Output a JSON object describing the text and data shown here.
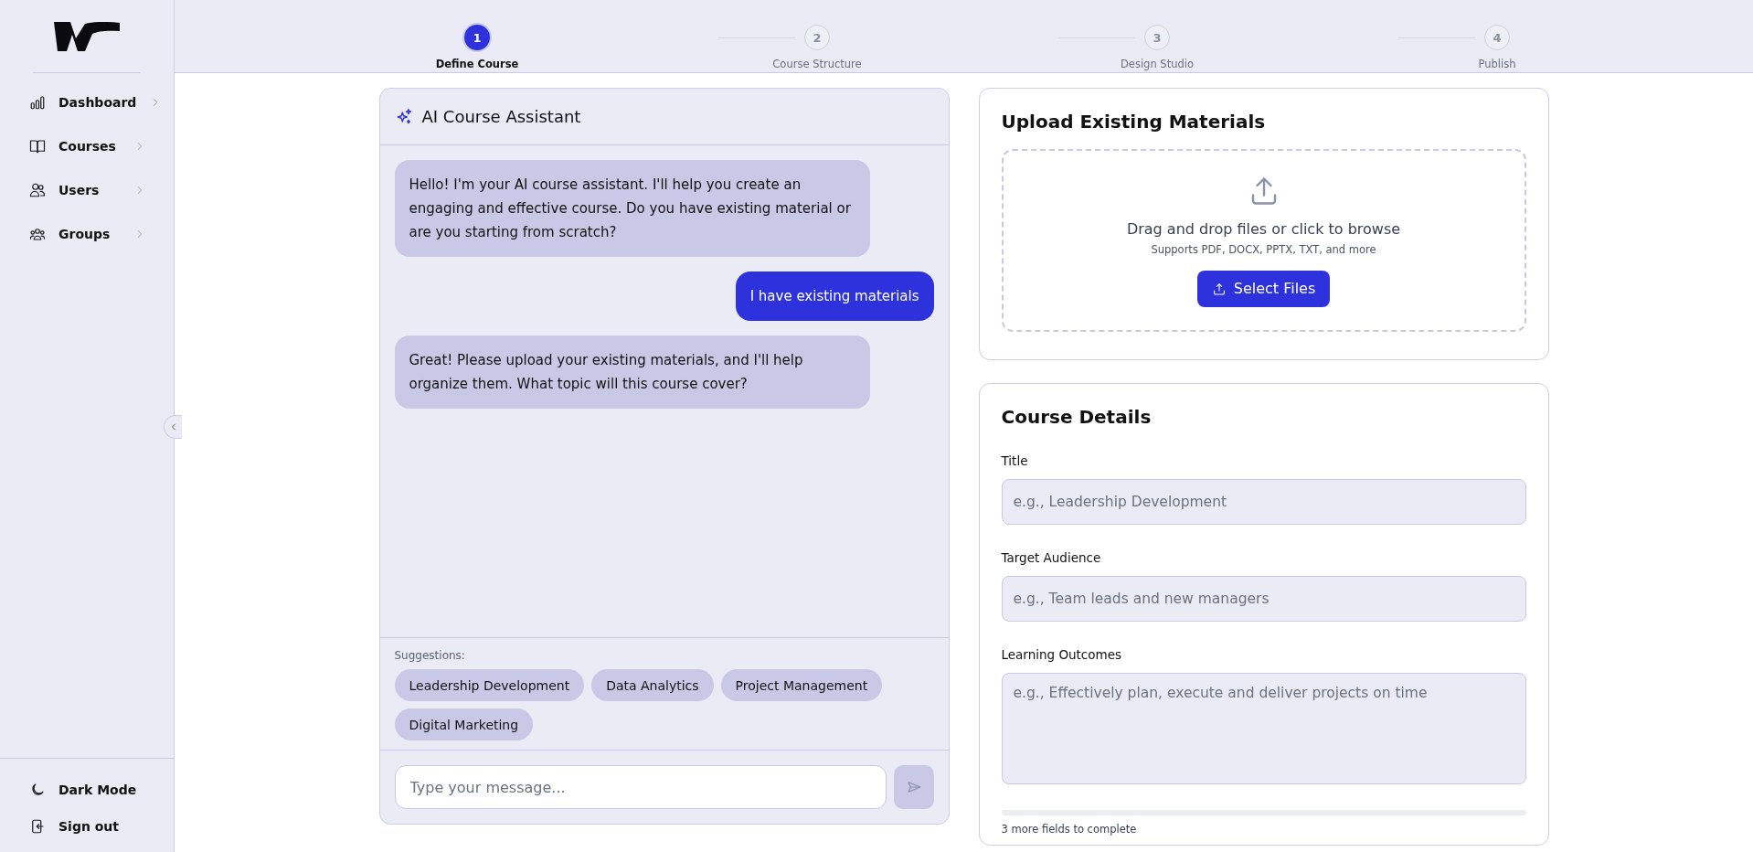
{
  "sidebar": {
    "nav_items": [
      {
        "label": "Dashboard"
      },
      {
        "label": "Courses"
      },
      {
        "label": "Users"
      },
      {
        "label": "Groups"
      }
    ],
    "footer_items": [
      {
        "label": "Dark Mode"
      },
      {
        "label": "Sign out"
      }
    ]
  },
  "stepper": [
    {
      "number": "1",
      "label": "Define Course",
      "selected": true
    },
    {
      "number": "2",
      "label": "Course Structure",
      "selected": false
    },
    {
      "number": "3",
      "label": "Design Studio",
      "selected": false
    },
    {
      "number": "4",
      "label": "Publish",
      "selected": false
    }
  ],
  "chat": {
    "title": "AI Course Assistant",
    "messages": [
      {
        "kind": "assistant",
        "text": "Hello! I'm your AI course assistant. I'll help you create an engaging and effective course. Do you have existing material or are you starting from scratch?"
      },
      {
        "kind": "user",
        "text": "I have existing materials"
      },
      {
        "kind": "assistant",
        "text": "Great! Please upload your existing materials, and I'll help organize them. What topic will this course cover?"
      }
    ],
    "suggestions_label": "Suggestions:",
    "suggestions": [
      "Leadership Development",
      "Data Analytics",
      "Project Management",
      "Digital Marketing"
    ],
    "input": {
      "placeholder": "Type your message..."
    }
  },
  "upload": {
    "title": "Upload Existing Materials",
    "prompt": "Drag and drop files or click to browse",
    "hint": "Supports PDF, DOCX, PPTX, TXT, and more",
    "button": "Select Files"
  },
  "details": {
    "title": "Course Details",
    "fields": [
      {
        "kind": "input",
        "label": "Title",
        "placeholder": "e.g., Leadership Development"
      },
      {
        "kind": "input",
        "label": "Target Audience",
        "placeholder": "e.g., Team leads and new managers"
      },
      {
        "kind": "textarea",
        "label": "Learning Outcomes",
        "placeholder": "e.g., Effectively plan, execute and deliver projects on time"
      }
    ],
    "progress": {
      "level": 0
    },
    "progress_text": "3 more fields to complete"
  }
}
